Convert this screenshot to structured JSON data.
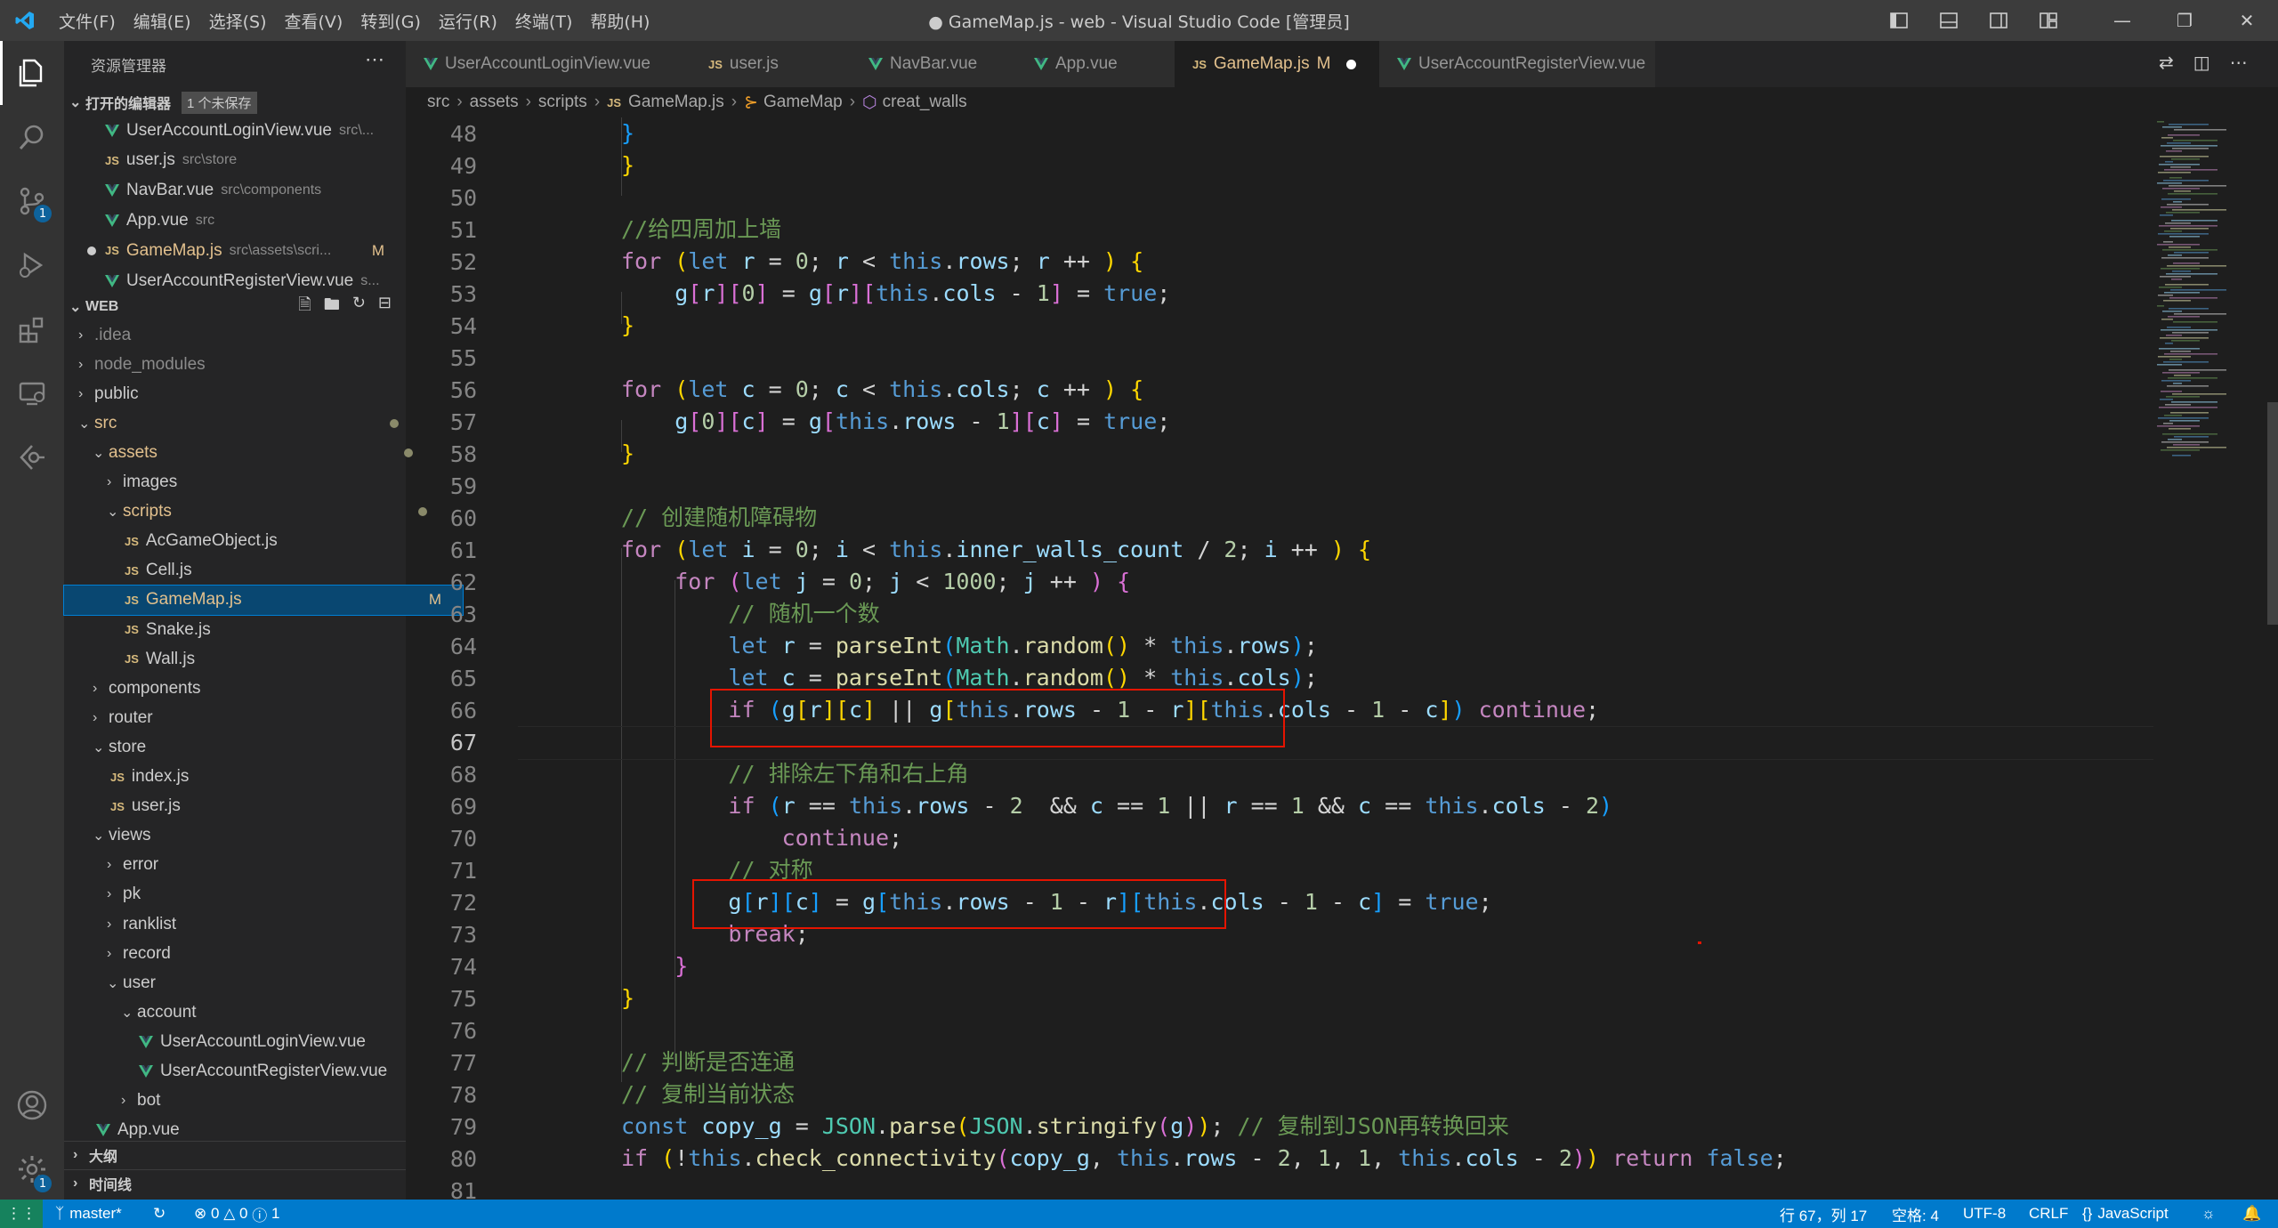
{
  "titlebar": {
    "menus": [
      "文件(F)",
      "编辑(E)",
      "选择(S)",
      "查看(V)",
      "转到(G)",
      "运行(R)",
      "终端(T)",
      "帮助(H)"
    ],
    "title": "● GameMap.js - web - Visual Studio Code [管理员]"
  },
  "activity": {
    "scm_badge": "1",
    "settings_badge": "1"
  },
  "sidebar": {
    "header": "资源管理器",
    "open_editors": {
      "title": "打开的编辑器",
      "unsaved": "1 个未保存",
      "items": [
        {
          "name": "UserAccountLoginView.vue",
          "desc": "src\\...",
          "type": "vue"
        },
        {
          "name": "user.js",
          "desc": "src\\store",
          "type": "js"
        },
        {
          "name": "NavBar.vue",
          "desc": "src\\components",
          "type": "vue"
        },
        {
          "name": "App.vue",
          "desc": "src",
          "type": "vue"
        },
        {
          "name": "GameMap.js",
          "desc": "src\\assets\\scri...",
          "type": "js",
          "flag": "M"
        },
        {
          "name": "UserAccountRegisterView.vue",
          "desc": "s...",
          "type": "vue"
        }
      ]
    },
    "workspace": {
      "title": "WEB",
      "tree": [
        {
          "label": ".idea",
          "kind": "folder",
          "depth": 0,
          "open": false,
          "dim": true
        },
        {
          "label": "node_modules",
          "kind": "folder",
          "depth": 0,
          "open": false,
          "dim": true
        },
        {
          "label": "public",
          "kind": "folder",
          "depth": 0,
          "open": false
        },
        {
          "label": "src",
          "kind": "folder",
          "depth": 0,
          "open": true,
          "mod": true
        },
        {
          "label": "assets",
          "kind": "folder",
          "depth": 1,
          "open": true,
          "mod": true
        },
        {
          "label": "images",
          "kind": "folder",
          "depth": 2,
          "open": false
        },
        {
          "label": "scripts",
          "kind": "folder",
          "depth": 2,
          "open": true,
          "mod": true
        },
        {
          "label": "AcGameObject.js",
          "kind": "js",
          "depth": 3
        },
        {
          "label": "Cell.js",
          "kind": "js",
          "depth": 3
        },
        {
          "label": "GameMap.js",
          "kind": "js",
          "depth": 3,
          "selected": true,
          "flag": "M"
        },
        {
          "label": "Snake.js",
          "kind": "js",
          "depth": 3
        },
        {
          "label": "Wall.js",
          "kind": "js",
          "depth": 3
        },
        {
          "label": "components",
          "kind": "folder",
          "depth": 1,
          "open": false
        },
        {
          "label": "router",
          "kind": "folder",
          "depth": 1,
          "open": false
        },
        {
          "label": "store",
          "kind": "folder",
          "depth": 1,
          "open": true
        },
        {
          "label": "index.js",
          "kind": "js",
          "depth": 2
        },
        {
          "label": "user.js",
          "kind": "js",
          "depth": 2
        },
        {
          "label": "views",
          "kind": "folder",
          "depth": 1,
          "open": true
        },
        {
          "label": "error",
          "kind": "folder",
          "depth": 2,
          "open": false
        },
        {
          "label": "pk",
          "kind": "folder",
          "depth": 2,
          "open": false
        },
        {
          "label": "ranklist",
          "kind": "folder",
          "depth": 2,
          "open": false
        },
        {
          "label": "record",
          "kind": "folder",
          "depth": 2,
          "open": false
        },
        {
          "label": "user",
          "kind": "folder",
          "depth": 2,
          "open": true
        },
        {
          "label": "account",
          "kind": "folder",
          "depth": 3,
          "open": true
        },
        {
          "label": "UserAccountLoginView.vue",
          "kind": "vue",
          "depth": 4
        },
        {
          "label": "UserAccountRegisterView.vue",
          "kind": "vue",
          "depth": 4
        },
        {
          "label": "bot",
          "kind": "folder",
          "depth": 3,
          "open": false
        },
        {
          "label": "App.vue",
          "kind": "vue",
          "depth": 1
        }
      ]
    },
    "outline": "大纲",
    "timeline": "时间线"
  },
  "tabs": [
    {
      "label": "UserAccountLoginView.vue",
      "type": "vue"
    },
    {
      "label": "user.js",
      "type": "js"
    },
    {
      "label": "NavBar.vue",
      "type": "vue"
    },
    {
      "label": "App.vue",
      "type": "vue"
    },
    {
      "label": "GameMap.js",
      "type": "js",
      "flag": "M",
      "active": true
    },
    {
      "label": "UserAccountRegisterView.vue",
      "type": "vue"
    }
  ],
  "breadcrumb": [
    "src",
    "assets",
    "scripts",
    "GameMap.js",
    "GameMap",
    "creat_walls"
  ],
  "editor": {
    "line_numbers": [
      "48",
      "49",
      "50",
      "51",
      "52",
      "53",
      "54",
      "55",
      "56",
      "57",
      "58",
      "59",
      "60",
      "61",
      "62",
      "63",
      "64",
      "65",
      "66",
      "67",
      "68",
      "69",
      "70",
      "71",
      "72",
      "73",
      "74",
      "75",
      "76",
      "77",
      "78",
      "79",
      "80",
      "81"
    ],
    "current_line": "67"
  },
  "status": {
    "branch": "master*",
    "errors": "0",
    "warnings": "0",
    "info": "1",
    "position": "行 67，列 17",
    "spaces": "空格: 4",
    "encoding": "UTF-8",
    "eol": "CRLF",
    "language": "JavaScript"
  }
}
